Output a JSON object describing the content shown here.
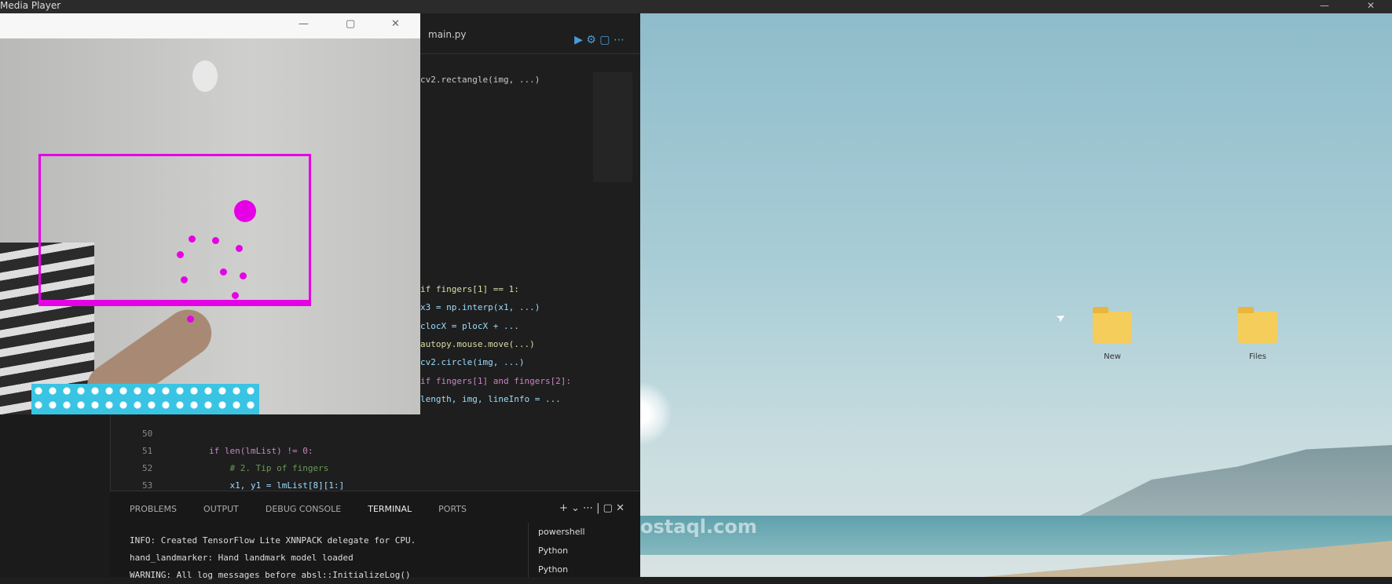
{
  "titlebar": {
    "title": "Media Player",
    "minimize": "—",
    "close": "✕"
  },
  "camera": {
    "controls": [
      "—",
      "▢",
      "✕"
    ]
  },
  "editor": {
    "breadcrumb": "main.py",
    "actions": "▶ ⚙ ▢ ⋯",
    "code_lines": [
      "cv2.rectangle(img, ...)",
      "if fingers[1] == 1:",
      "x3 = np.interp(x1, ...)",
      "clocX = plocX + ...",
      "autopy.mouse.move(...)",
      "cv2.circle(img, ...)",
      "if fingers[1] and fingers[2]:",
      "length, img, lineInfo = ..."
    ],
    "line_numbers": [
      "50",
      "51",
      "52",
      "53"
    ],
    "lower_code": [
      "if len(lmList) != 0:",
      "    # 2. Tip of fingers",
      "    x1, y1 = lmList[8][1:]"
    ]
  },
  "panel": {
    "tabs": [
      "PROBLEMS",
      "OUTPUT",
      "DEBUG CONSOLE",
      "TERMINAL",
      "PORTS"
    ],
    "active_tab": "TERMINAL",
    "actions": "+ ⌄ ⋯ | ▢ ✕",
    "terminal": [
      "INFO: Created TensorFlow Lite XNNPACK delegate for CPU.",
      "hand_landmarker: Hand landmark model loaded",
      "WARNING: All log messages before absl::InitializeLog()"
    ],
    "terminals": [
      "powershell",
      "Python",
      "Python"
    ]
  },
  "desktop": {
    "folders": [
      {
        "label": "New"
      },
      {
        "label": "Files"
      }
    ],
    "watermark": "mostaql.com"
  }
}
